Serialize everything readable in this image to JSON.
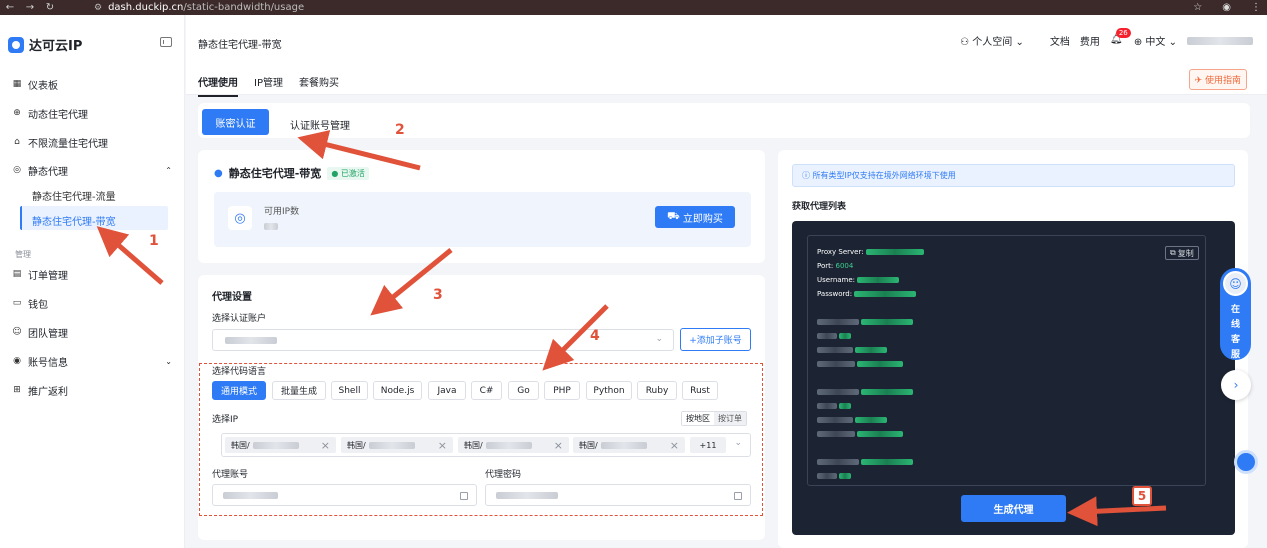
{
  "browser": {
    "domain": "dash.duckip.cn",
    "path": "/static-bandwidth/usage"
  },
  "sidebar": {
    "brand": "达可云IP",
    "items": [
      {
        "label": "仪表板",
        "icon": "dashboard-icon"
      },
      {
        "label": "动态住宅代理",
        "icon": "globe-icon"
      },
      {
        "label": "不限流量住宅代理",
        "icon": "house-icon"
      },
      {
        "label": "静态代理",
        "icon": "target-icon"
      }
    ],
    "sub_items": [
      "静态住宅代理-流量",
      "静态住宅代理-带宽"
    ],
    "group_label": "管理",
    "manage_items": [
      {
        "label": "订单管理",
        "icon": "order-icon"
      },
      {
        "label": "钱包",
        "icon": "wallet-icon"
      },
      {
        "label": "团队管理",
        "icon": "team-icon"
      },
      {
        "label": "账号信息",
        "icon": "user-circle-icon"
      },
      {
        "label": "推广返利",
        "icon": "gift-icon"
      }
    ]
  },
  "header": {
    "title": "静态住宅代理-带宽",
    "personal_space": "个人空间",
    "docs": "文档",
    "fees": "费用",
    "notification_count": "26",
    "language": "中文",
    "tabs": [
      "代理使用",
      "IP管理",
      "套餐购买"
    ],
    "guide": "使用指南"
  },
  "auth_tabs": {
    "account_auth": "账密认证",
    "manage": "认证账号管理"
  },
  "product": {
    "name": "静态住宅代理-带宽",
    "status": "已激活",
    "available_label": "可用IP数",
    "buy": "立即购买"
  },
  "proxy_settings": {
    "title": "代理设置",
    "select_account": "选择认证账户",
    "add_sub_account": "+添加子账号",
    "code_lang_label": "选择代码语言",
    "languages": [
      "通用模式",
      "批量生成",
      "Shell",
      "Node.js",
      "Java",
      "C#",
      "Go",
      "PHP",
      "Python",
      "Ruby",
      "Rust"
    ],
    "select_ip": "选择IP",
    "by_region": "按地区",
    "by_order": "按订单",
    "ip_chips": [
      "韩国/",
      "韩国/",
      "韩国/",
      "韩国/"
    ],
    "more_count": "+11",
    "username_label": "代理账号",
    "password_label": "代理密码"
  },
  "right_panel": {
    "info": "所有类型IP仅支持在境外网络环境下使用",
    "list_title": "获取代理列表",
    "copy": "复制",
    "proxy_server_label": "Proxy Server:",
    "port_label": "Port:",
    "port_value": "6004",
    "username_label": "Username:",
    "password_label": "Password:",
    "generate": "生成代理"
  },
  "support": {
    "chars": [
      "在",
      "线",
      "客",
      "服"
    ]
  },
  "annotations": [
    "1",
    "2",
    "3",
    "4",
    "5"
  ],
  "colors": {
    "primary": "#2f7bf5",
    "annotation": "#e0523a",
    "success": "#21a366",
    "code_bg": "#1c2433"
  }
}
